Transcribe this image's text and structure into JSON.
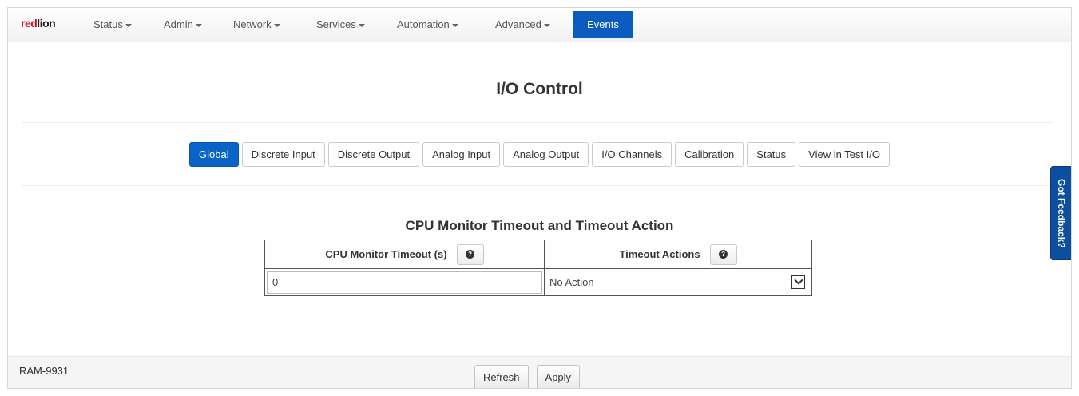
{
  "nav": {
    "logo_red": "red",
    "logo_lion": "lion",
    "items": [
      {
        "label": "Status"
      },
      {
        "label": "Admin"
      },
      {
        "label": "Network"
      },
      {
        "label": "Services"
      },
      {
        "label": "Automation"
      },
      {
        "label": "Advanced"
      }
    ],
    "events": "Events"
  },
  "page": {
    "title": "I/O Control"
  },
  "tabs": [
    {
      "label": "Global",
      "active": true
    },
    {
      "label": "Discrete Input"
    },
    {
      "label": "Discrete Output"
    },
    {
      "label": "Analog Input"
    },
    {
      "label": "Analog Output"
    },
    {
      "label": "I/O Channels"
    },
    {
      "label": "Calibration"
    },
    {
      "label": "Status"
    },
    {
      "label": "View in Test I/O"
    }
  ],
  "section": {
    "title": "CPU Monitor Timeout and Timeout Action",
    "col_timeout": "CPU Monitor Timeout (s)",
    "col_actions": "Timeout Actions",
    "timeout_value": "0",
    "action_selected": "No Action"
  },
  "footer": {
    "device": "RAM-9931",
    "refresh": "Refresh",
    "apply": "Apply"
  },
  "feedback": "Got Feedback?",
  "colors": {
    "accent": "#0a63c6",
    "feedback_bg": "#0c4f9e",
    "logo_red": "#c8102e"
  },
  "icons": {
    "help": "question-circle-icon",
    "dropdown": "chevron-down-icon",
    "caret": "caret-down-icon"
  }
}
